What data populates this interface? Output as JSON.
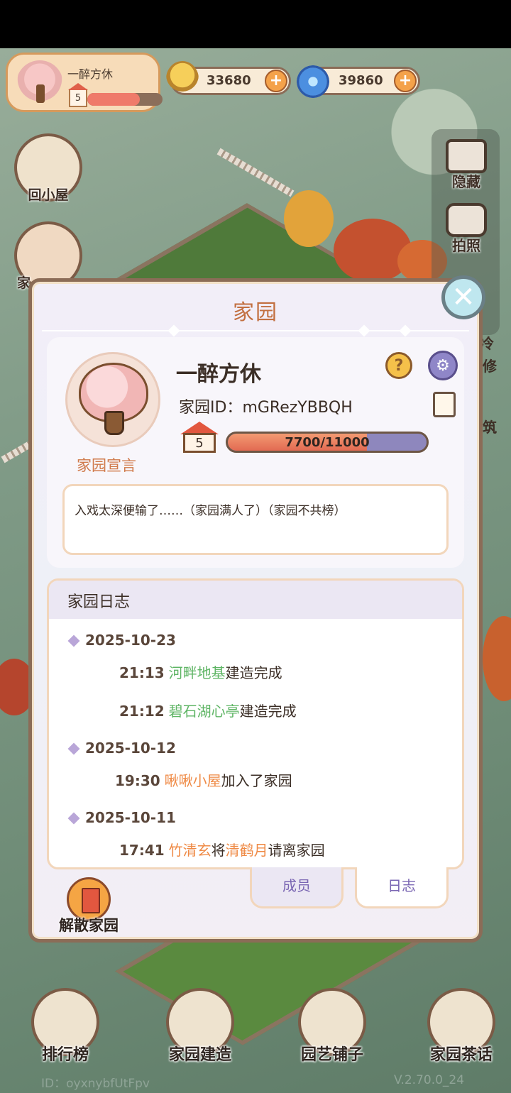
{
  "topbar": {
    "player_name": "一醉方休",
    "player_level": "5",
    "player_level_progress": 0.7,
    "currency_snail": "33680",
    "currency_spiral": "39860",
    "plus_symbol": "+"
  },
  "side_left": {
    "back_home_label": "回小屋",
    "gift_label": "家"
  },
  "side_right": {
    "hide_label": "隐藏",
    "photo_label": "拍照",
    "partial_1": "冷",
    "partial_2": "修",
    "partial_3": "筑"
  },
  "dialog": {
    "title": "家园",
    "close_symbol": "✕",
    "home_name": "一醉方休",
    "home_id_label": "家园ID：",
    "home_id_value": "mGRezYBBQH",
    "help_symbol": "?",
    "gear_symbol": "⚙",
    "level": "5",
    "exp_text": "7700/11000",
    "exp_current": 7700,
    "exp_max": 11000,
    "manifesto_label": "家园宣言",
    "manifesto_text": "入戏太深便输了……（家园满人了）（家园不共榜）",
    "log_title": "家园日志",
    "log_groups": [
      {
        "date": "2025-10-23",
        "entries": [
          {
            "time": "21:13",
            "subject": "河畔地基",
            "subject_color": "green",
            "action": "建造完成"
          },
          {
            "time": "21:12",
            "subject": "碧石湖心亭",
            "subject_color": "green",
            "action": "建造完成"
          }
        ]
      },
      {
        "date": "2025-10-12",
        "entries": [
          {
            "time": "19:30",
            "subject": "啾啾小屋",
            "subject_color": "orange",
            "action": "加入了家园"
          }
        ]
      },
      {
        "date": "2025-10-11",
        "entries": [
          {
            "time": "17:41",
            "subject": "竹清玄",
            "subject_color": "orange",
            "mid": "将",
            "object": "清鹤月",
            "action": "请离家园"
          }
        ]
      }
    ],
    "tab_members": "成员",
    "tab_log": "日志",
    "disband_label": "解散家园"
  },
  "bottom_nav": {
    "ranking": "排行榜",
    "build": "家园建造",
    "shop": "园艺铺子",
    "tea": "家园茶话"
  },
  "footer": {
    "id_text": "ID：oyxnybfUtFpv",
    "version": "V.2.70.0_24"
  },
  "colors": {
    "accent_orange": "#c26f40",
    "log_green": "#5fb565",
    "log_orange": "#ef8a45",
    "tab_purple": "#7a66b3"
  },
  "icons": [
    "avatar-icon",
    "level-house-icon",
    "snail-coin-icon",
    "spiral-coin-icon",
    "plus-icon",
    "house-icon",
    "gift-icon",
    "hide-icon",
    "camera-icon",
    "close-icon",
    "help-icon",
    "gear-icon",
    "copy-icon",
    "exit-door-icon",
    "ranking-icon",
    "build-icon",
    "shop-basket-icon",
    "chat-icon"
  ]
}
